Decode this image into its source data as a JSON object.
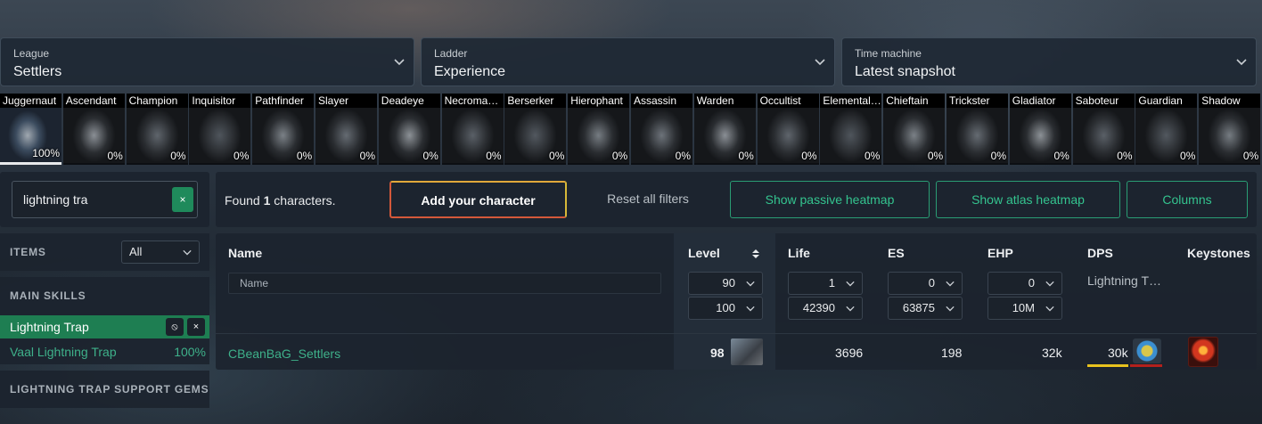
{
  "selectors": {
    "league": {
      "label": "League",
      "value": "Settlers"
    },
    "ladder": {
      "label": "Ladder",
      "value": "Experience"
    },
    "time_machine": {
      "label": "Time machine",
      "value": "Latest snapshot"
    }
  },
  "classes": [
    {
      "name": "Juggernaut",
      "pct": "100%"
    },
    {
      "name": "Ascendant",
      "pct": "0%"
    },
    {
      "name": "Champion",
      "pct": "0%"
    },
    {
      "name": "Inquisitor",
      "pct": "0%"
    },
    {
      "name": "Pathfinder",
      "pct": "0%"
    },
    {
      "name": "Slayer",
      "pct": "0%"
    },
    {
      "name": "Deadeye",
      "pct": "0%"
    },
    {
      "name": "Necroma…",
      "pct": "0%"
    },
    {
      "name": "Berserker",
      "pct": "0%"
    },
    {
      "name": "Hierophant",
      "pct": "0%"
    },
    {
      "name": "Assassin",
      "pct": "0%"
    },
    {
      "name": "Warden",
      "pct": "0%"
    },
    {
      "name": "Occultist",
      "pct": "0%"
    },
    {
      "name": "Elemental…",
      "pct": "0%"
    },
    {
      "name": "Chieftain",
      "pct": "0%"
    },
    {
      "name": "Trickster",
      "pct": "0%"
    },
    {
      "name": "Gladiator",
      "pct": "0%"
    },
    {
      "name": "Saboteur",
      "pct": "0%"
    },
    {
      "name": "Guardian",
      "pct": "0%"
    },
    {
      "name": "Shadow",
      "pct": "0%"
    }
  ],
  "search": {
    "value": "lightning tra",
    "clear_label": "×"
  },
  "toolbar": {
    "found_prefix": "Found ",
    "found_count": "1",
    "found_suffix": " characters.",
    "add_character": "Add your character",
    "reset_filters": "Reset all filters",
    "passive_heatmap": "Show passive heatmap",
    "atlas_heatmap": "Show atlas heatmap",
    "columns": "Columns"
  },
  "sidebar": {
    "items_title": "ITEMS",
    "items_select": "All",
    "main_skills_title": "MAIN SKILLS",
    "active_skill": "Lightning Trap",
    "skill_block_icon": "⦸",
    "skill_remove_icon": "×",
    "vaal_skill": "Vaal Lightning Trap",
    "vaal_pct": "100%",
    "support_title": "LIGHTNING TRAP SUPPORT GEMS"
  },
  "table": {
    "headers": {
      "name": "Name",
      "level": "Level",
      "life": "Life",
      "es": "ES",
      "ehp": "EHP",
      "dps": "DPS",
      "keystones": "Keystones"
    },
    "name_placeholder": "Name",
    "filters": {
      "level_min": "90",
      "level_max": "100",
      "life_min": "1",
      "life_max": "42390",
      "es_min": "0",
      "es_max": "63875",
      "ehp_min": "0",
      "ehp_max": "10M",
      "dps_filter": "Lightning T…"
    },
    "row": {
      "name": "CBeanBaG_Settlers",
      "level": "98",
      "life": "3696",
      "es": "198",
      "ehp": "32k",
      "dps": "30k"
    }
  },
  "colors": {
    "accent_green": "#1f8a5b",
    "link_green": "#3eb18a",
    "add_border": "#d4583a",
    "dps_bar_yellow": "#e8c21e",
    "dps_bar_red": "#b3201c"
  },
  "icons": [
    "chevron-down-icon",
    "sort-icon",
    "close-icon",
    "block-icon"
  ]
}
